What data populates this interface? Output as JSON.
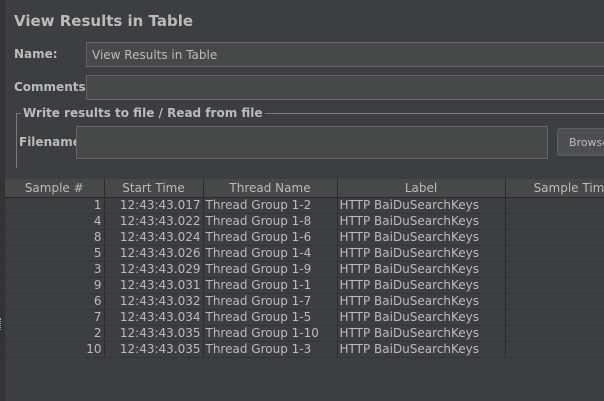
{
  "window": {
    "title": "View Results in Table"
  },
  "form": {
    "name_label": "Name:",
    "name_value": "View Results in Table",
    "comments_label": "Comments:",
    "comments_value": "",
    "file_group_title": "Write results to file / Read from file",
    "filename_label": "Filename",
    "filename_value": "",
    "browse_label": "Browse..."
  },
  "table": {
    "headers": [
      "Sample #",
      "Start Time",
      "Thread Name",
      "Label",
      "Sample Time("
    ],
    "rows": [
      [
        "1",
        "12:43:43.017",
        "Thread Group 1-2",
        "HTTP BaiDuSearchKeys",
        ""
      ],
      [
        "4",
        "12:43:43.022",
        "Thread Group 1-8",
        "HTTP BaiDuSearchKeys",
        ""
      ],
      [
        "8",
        "12:43:43.024",
        "Thread Group 1-6",
        "HTTP BaiDuSearchKeys",
        ""
      ],
      [
        "5",
        "12:43:43.026",
        "Thread Group 1-4",
        "HTTP BaiDuSearchKeys",
        ""
      ],
      [
        "3",
        "12:43:43.029",
        "Thread Group 1-9",
        "HTTP BaiDuSearchKeys",
        ""
      ],
      [
        "9",
        "12:43:43.031",
        "Thread Group 1-1",
        "HTTP BaiDuSearchKeys",
        ""
      ],
      [
        "6",
        "12:43:43.032",
        "Thread Group 1-7",
        "HTTP BaiDuSearchKeys",
        ""
      ],
      [
        "7",
        "12:43:43.034",
        "Thread Group 1-5",
        "HTTP BaiDuSearchKeys",
        ""
      ],
      [
        "2",
        "12:43:43.035",
        "Thread Group 1-10",
        "HTTP BaiDuSearchKeys",
        ""
      ],
      [
        "10",
        "12:43:43.035",
        "Thread Group 1-3",
        "HTTP BaiDuSearchKeys",
        ""
      ]
    ]
  },
  "colors": {
    "background": "#3c3f41",
    "field_background": "#45494a",
    "text": "#bbbbbb"
  }
}
